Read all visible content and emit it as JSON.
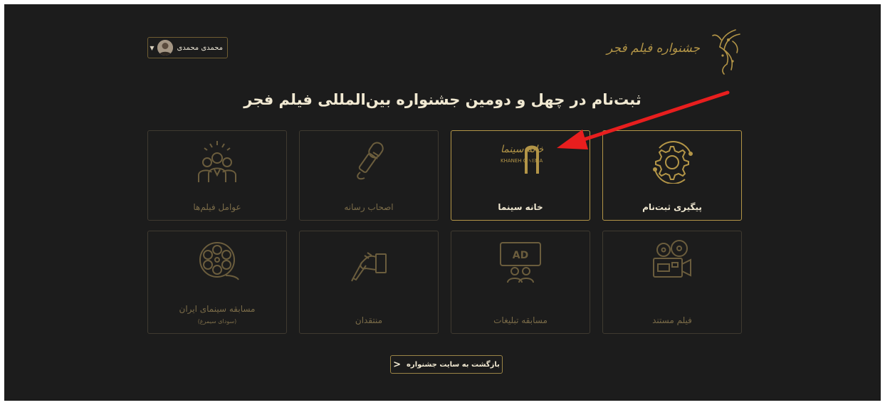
{
  "header": {
    "user_name": "محمدی محمدی",
    "logo_text": "جشنواره فیلم فجر"
  },
  "page_title": "ثبت‌نام در چهل و دومین جشنواره بین‌المللی فیلم فجر",
  "tiles_row1": [
    {
      "label": "پیگیری ثبت‌نام",
      "icon": "gear-registration-icon"
    },
    {
      "label": "خانه سینما",
      "icon": "khaneh-cinema-logo",
      "logo_text": "KHANEH CINEMA"
    },
    {
      "label": "اصحاب رسانه",
      "icon": "microphone-icon"
    },
    {
      "label": "عوامل فیلم‌ها",
      "icon": "group-people-icon"
    }
  ],
  "tiles_row2": [
    {
      "label": "فیلم مستند",
      "icon": "film-camera-icon"
    },
    {
      "label": "مسابقه تبلیغات",
      "icon": "ad-screen-icon",
      "badge": "AD"
    },
    {
      "label": "منتقدان",
      "icon": "writing-hand-icon"
    },
    {
      "label": "مسابقه سینمای ایران",
      "sub": "(سودای سیمرغ)",
      "icon": "film-reel-icon"
    }
  ],
  "back_button": "بازگشت به سایت جشنواره",
  "colors": {
    "background": "#1c1c1c",
    "gold": "#b39547",
    "border": "#3f3a30",
    "annotation_arrow": "#e81e1e"
  }
}
